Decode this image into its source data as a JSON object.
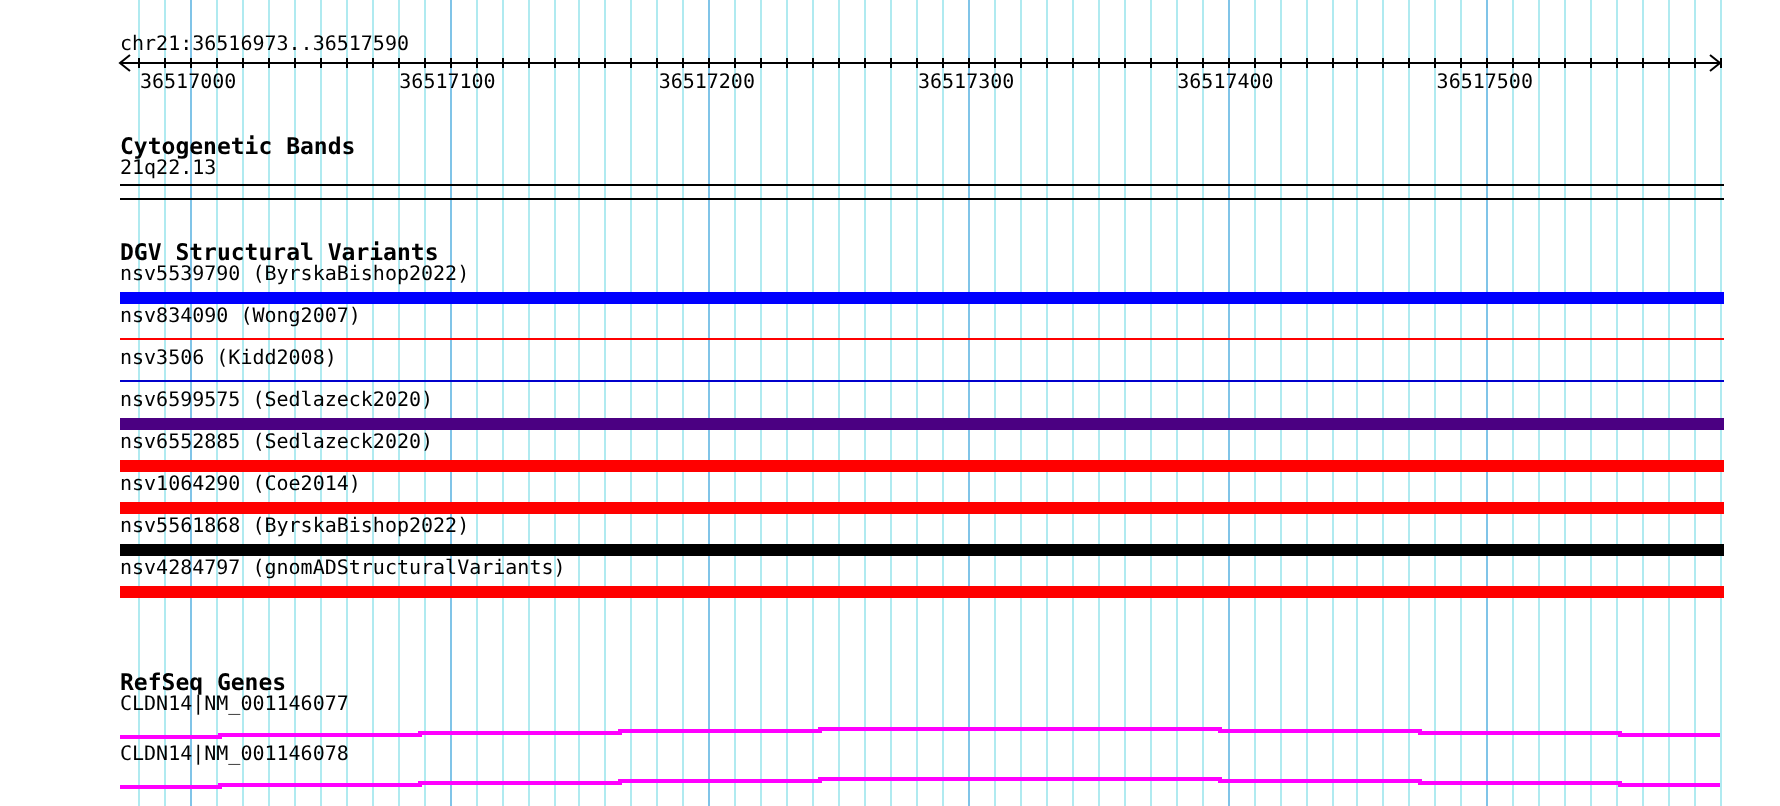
{
  "ruler": {
    "region": "chr21:36516973..36517590",
    "ticks": [
      "36517000",
      "36517100",
      "36517200",
      "36517300",
      "36517400",
      "36517500"
    ]
  },
  "tracks": [
    {
      "kind": "bands",
      "title": "Cytogenetic Bands",
      "features": [
        {
          "label": "21q22.13",
          "kind": "band"
        }
      ]
    },
    {
      "kind": "variants",
      "title": "DGV Structural Variants",
      "features": [
        {
          "label": "nsv5539790 (ByrskaBishop2022)",
          "kind": "bar",
          "color": "#0000ff"
        },
        {
          "label": "nsv834090 (Wong2007)",
          "kind": "line",
          "color": "#ff0000"
        },
        {
          "label": "nsv3506 (Kidd2008)",
          "kind": "line",
          "color": "#0000cc"
        },
        {
          "label": "nsv6599575 (Sedlazeck2020)",
          "kind": "bar",
          "color": "#4b0082"
        },
        {
          "label": "nsv6552885 (Sedlazeck2020)",
          "kind": "bar",
          "color": "#ff0000"
        },
        {
          "label": "nsv1064290 (Coe2014)",
          "kind": "bar",
          "color": "#ff0000"
        },
        {
          "label": "nsv5561868 (ByrskaBishop2022)",
          "kind": "bar",
          "color": "#000000"
        },
        {
          "label": "nsv4284797 (gnomADStructuralVariants)",
          "kind": "bar",
          "color": "#ff0000"
        }
      ]
    },
    {
      "kind": "genes",
      "title": "RefSeq Genes",
      "features": [
        {
          "label": "CLDN14|NM_001146077",
          "kind": "gene",
          "color": "#ff00ff"
        },
        {
          "label": "CLDN14|NM_001146078",
          "kind": "gene",
          "color": "#ff00ff"
        }
      ]
    }
  ]
}
